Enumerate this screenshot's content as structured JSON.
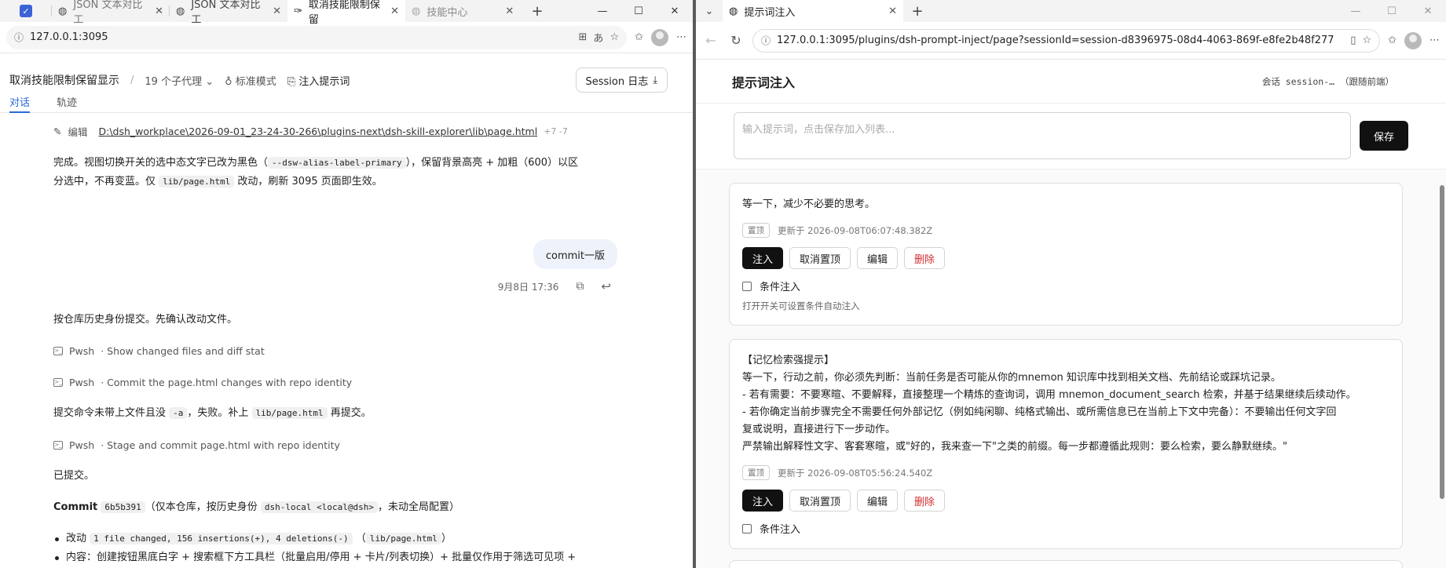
{
  "left": {
    "tabs": [
      {
        "label": "",
        "icon": "checkbox-icon"
      },
      {
        "label": "JSON 文本对比工",
        "icon": "globe-icon"
      },
      {
        "label": "JSON 文本对比工",
        "icon": "globe-icon"
      },
      {
        "label": "取消技能限制保留",
        "icon": "app-icon"
      },
      {
        "label": "技能中心",
        "icon": "globe-icon"
      }
    ],
    "url": "127.0.0.1:3095",
    "header": {
      "title": "取消技能限制保留显示",
      "sep": "/",
      "agents": "19 个子代理",
      "mode": "标准模式",
      "inject": "注入提示词",
      "session_btn": "Session 日志"
    },
    "view_tabs": [
      "对话",
      "轨迹"
    ],
    "edit_line": {
      "label": "编辑",
      "path": "D:\\dsh_workplace\\2026-09-01_23-24-30-266\\plugins-next\\dsh-skill-explorer\\lib\\page.html",
      "diff": "+7 -7"
    },
    "msg1": {
      "a": "完成。视图切换开关的选中态文字已改为黑色（",
      "code": "--dsw-alias-label-primary",
      "b": "），保留背景高亮 + 加粗（600）以区",
      "c": "分选中，不再变蓝。仅",
      "code2": "lib/page.html",
      "d": "改动，刷新 3095 页面即生效。"
    },
    "user_msg": "commit一版",
    "user_time": "9月8日 17:36",
    "msg2": "按仓库历史身份提交。先确认改动文件。",
    "tool1": {
      "name": "Pwsh",
      "desc": "· Show changed files and diff stat"
    },
    "tool2": {
      "name": "Pwsh",
      "desc": "· Commit the page.html changes with repo identity"
    },
    "msg3": {
      "a": "提交命令未带上文件且没",
      "code": "-a",
      "b": "，失败。补上",
      "code2": "lib/page.html",
      "c": "再提交。"
    },
    "tool3": {
      "name": "Pwsh",
      "desc": "· Stage and commit page.html with repo identity"
    },
    "msg4": "已提交。",
    "commit": {
      "label": "Commit",
      "hash": "6b5b391",
      "a": "（仅本仓库，按历史身份",
      "ident": "dsh-local <local@dsh>",
      "b": "，未动全局配置）"
    },
    "bullets": [
      {
        "a": "改动",
        "code": "1 file changed, 156 insertions(+), 4 deletions(-)",
        "b": "（",
        "code2": "lib/page.html",
        "c": "）"
      },
      {
        "a": "内容：创建按钮黑底白字 + 搜索框下方工具栏（批量启用/停用 + 卡片/列表切换）+ 批量仅作用于筛选可见项 +",
        "code": "",
        "b": "",
        "code2": "",
        "c": ""
      }
    ]
  },
  "right": {
    "tab": {
      "label": "提示词注入",
      "icon": "globe-icon"
    },
    "url": "127.0.0.1:3095/plugins/dsh-prompt-inject/page?sessionId=session-d8396975-08d4-4063-869f-e8fe2b48f277",
    "title": "提示词注入",
    "session_info": "会话 session-… （跟随前端）",
    "composer_placeholder": "输入提示词，点击保存加入列表...",
    "save_label": "保存",
    "cards": [
      {
        "text": [
          "等一下，减少不必要的思考。"
        ],
        "pin": "置顶",
        "updated": "更新于 2026-09-08T06:07:48.382Z",
        "actions": [
          "注入",
          "取消置顶",
          "编辑",
          "删除"
        ],
        "cond": "条件注入",
        "hint": "打开开关可设置条件自动注入"
      },
      {
        "text": [
          "【记忆检索强提示】",
          "等一下，行动之前，你必须先判断：当前任务是否可能从你的mnemon 知识库中找到相关文档、先前结论或踩坑记录。",
          "- 若有需要：不要寒暄、不要解释，直接整理一个精炼的查询词，调用 mnemon_document_search 检索，并基于结果继续后续动作。",
          "- 若你确定当前步骤完全不需要任何外部记忆（例如纯闲聊、纯格式输出、或所需信息已在当前上下文中完备）：不要输出任何文字回",
          "复或说明，直接进行下一步动作。",
          "严禁输出解释性文字、客套寒暄，或\"好的，我来查一下\"之类的前缀。每一步都遵循此规则：要么检索，要么静默继续。\""
        ],
        "pin": "置顶",
        "updated": "更新于 2026-09-08T05:56:24.540Z",
        "actions": [
          "注入",
          "取消置顶",
          "编辑",
          "删除"
        ],
        "cond": "条件注入",
        "hint": ""
      }
    ]
  }
}
